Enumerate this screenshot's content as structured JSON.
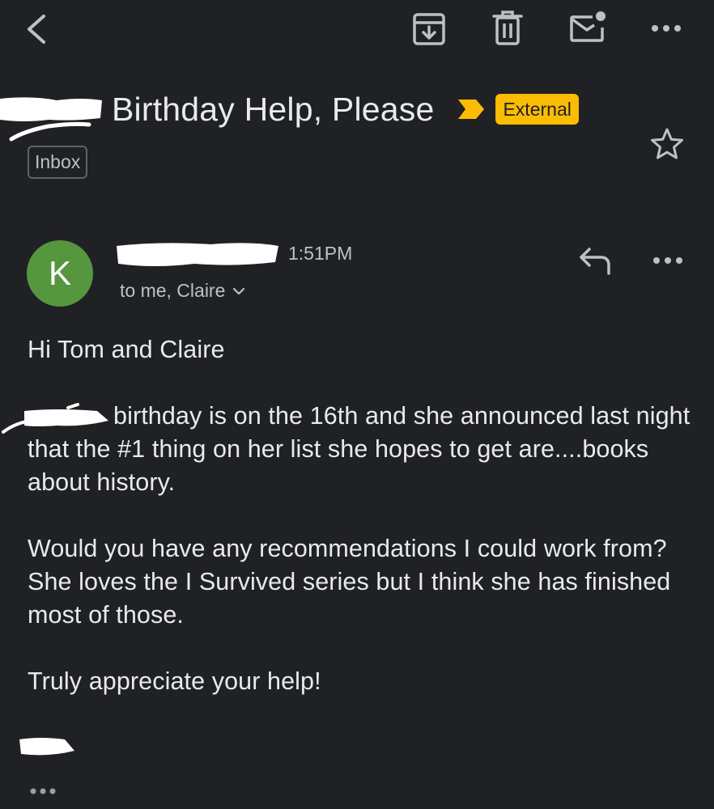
{
  "toolbar": {
    "back_icon": "back-arrow-icon",
    "archive_icon": "archive-icon",
    "delete_icon": "trash-icon",
    "unread_icon": "mark-unread-icon",
    "more_icon": "more-horizontal-icon"
  },
  "email": {
    "subject": "Birthday Help, Please",
    "external_label": "External",
    "folder_label": "Inbox",
    "star_icon": "star-outline-icon"
  },
  "message": {
    "avatar_letter": "K",
    "avatar_color": "#55963f",
    "time": "1:51PM",
    "recipients": "to me, Claire",
    "greeting": "Hi Tom and Claire",
    "paragraph1": "birthday is on the 16th and she announced last night that the #1 thing on her list she hopes to get are....books about history.",
    "paragraph2": "Would you have any recommendations I could work from? She loves the I Survived series but I think she has finished most of those.",
    "paragraph3": "Truly appreciate your help!"
  },
  "colors": {
    "background": "#202124",
    "external_badge": "#fbbc04",
    "important_marker": "#fbbc04",
    "text": "#e8eaed",
    "secondary_text": "#bdc1c6"
  }
}
